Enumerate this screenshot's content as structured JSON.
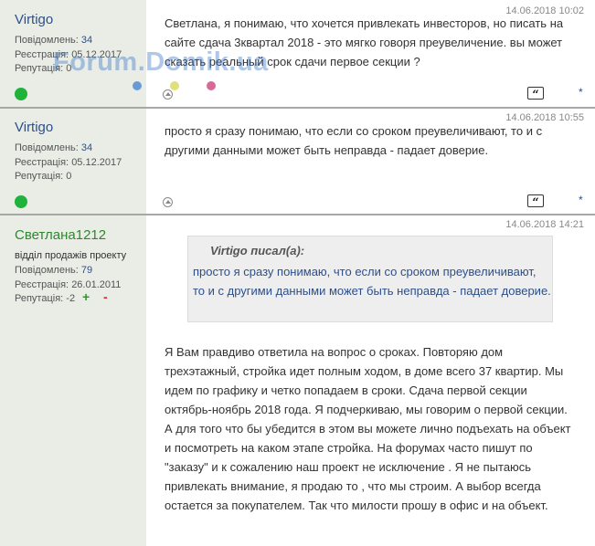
{
  "watermark": "Forum.Domik.ua",
  "labels": {
    "posts": "Повідомлень:",
    "registered": "Реєстрація:",
    "reputation": "Репутація:"
  },
  "icons": {
    "quote": "quote-icon",
    "up": "arrow-up-icon",
    "online": "online-status-icon",
    "permalink": "asterisk-icon"
  },
  "posts": [
    {
      "author": "Virtigo",
      "posts_count": "34",
      "registered": "05.12.2017",
      "reputation": "0",
      "date": "14.06.2018 10:02",
      "text": "Светлана, я понимаю, что хочется привлекать инвесторов, но писать на сайте сдача 3квартал 2018 - это мягко говоря преувеличение. вы может сказать реальный срок сдачи первое секции ?",
      "permalink": "*"
    },
    {
      "author": "Virtigo",
      "posts_count": "34",
      "registered": "05.12.2017",
      "reputation": "0",
      "date": "14.06.2018 10:55",
      "text": "просто я сразу понимаю, что если со сроком преувеличивают, то и с другими данными может быть неправда - падает доверие.",
      "permalink": "*"
    },
    {
      "author": "Светлана1212",
      "role": "відділ продажів проекту",
      "posts_count": "79",
      "registered": "26.01.2011",
      "reputation": "-2",
      "vote_plus": "+",
      "vote_minus": "-",
      "date": "14.06.2018 14:21",
      "quote": {
        "author": "Virtigo писал(а):",
        "text": "просто я сразу понимаю, что если со сроком преувеличивают, то и с другими данными может быть неправда - падает доверие."
      },
      "text": "Я Вам правдиво ответила на вопрос о сроках. Повторяю дом трехэтажный, стройка идет полным ходом, в доме всего 37 квартир. Мы идем по графику и четко попадаем в сроки. Сдача первой секции октябрь-ноябрь 2018 года. Я подчеркиваю, мы говорим о первой секции. А для того что бы убедится в этом вы можете лично подъехать на объект и посмотреть на каком этапе стройка. На форумах часто пишут по \"заказу\" и к сожалению наш проект не исключение . Я не пытаюсь привлекать внимание, я продаю то , что мы строим. А выбор всегда остается за покупателем. Так что милости прошу в офис и на объект."
    }
  ],
  "colors": {
    "sidebar_bg": "#e9ede6",
    "author_link": "#2c4f8a",
    "author_green": "#2b8a2b",
    "online": "#1fb33a",
    "vote_plus": "#2b9a2b",
    "vote_minus": "#d0302a",
    "dot_blue": "#6a9ad6",
    "dot_yellow": "#e0e07a",
    "dot_pink": "#d86a98"
  }
}
